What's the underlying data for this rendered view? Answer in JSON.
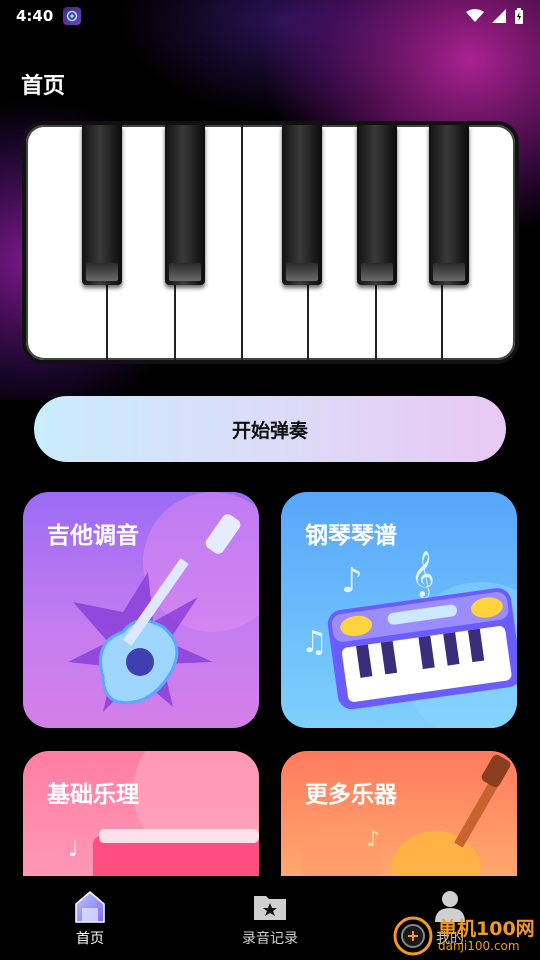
{
  "status": {
    "time": "4:40"
  },
  "header": {
    "title": "首页"
  },
  "start_button": {
    "label": "开始弹奏"
  },
  "cards": [
    {
      "title": "吉他调音"
    },
    {
      "title": "钢琴琴谱"
    },
    {
      "title": "基础乐理"
    },
    {
      "title": "更多乐器"
    }
  ],
  "nav": {
    "items": [
      {
        "label": "首页",
        "icon": "home-icon",
        "active": true
      },
      {
        "label": "录音记录",
        "icon": "folder-star-icon",
        "active": false
      },
      {
        "label": "我的",
        "icon": "person-icon",
        "active": false
      }
    ]
  },
  "watermark": {
    "main": "单机100网",
    "sub": "danji100.com"
  },
  "colors": {
    "button_gradient_start": "#c9ecfb",
    "button_gradient_end": "#e8c8f4",
    "watermark": "#f39a1e"
  }
}
